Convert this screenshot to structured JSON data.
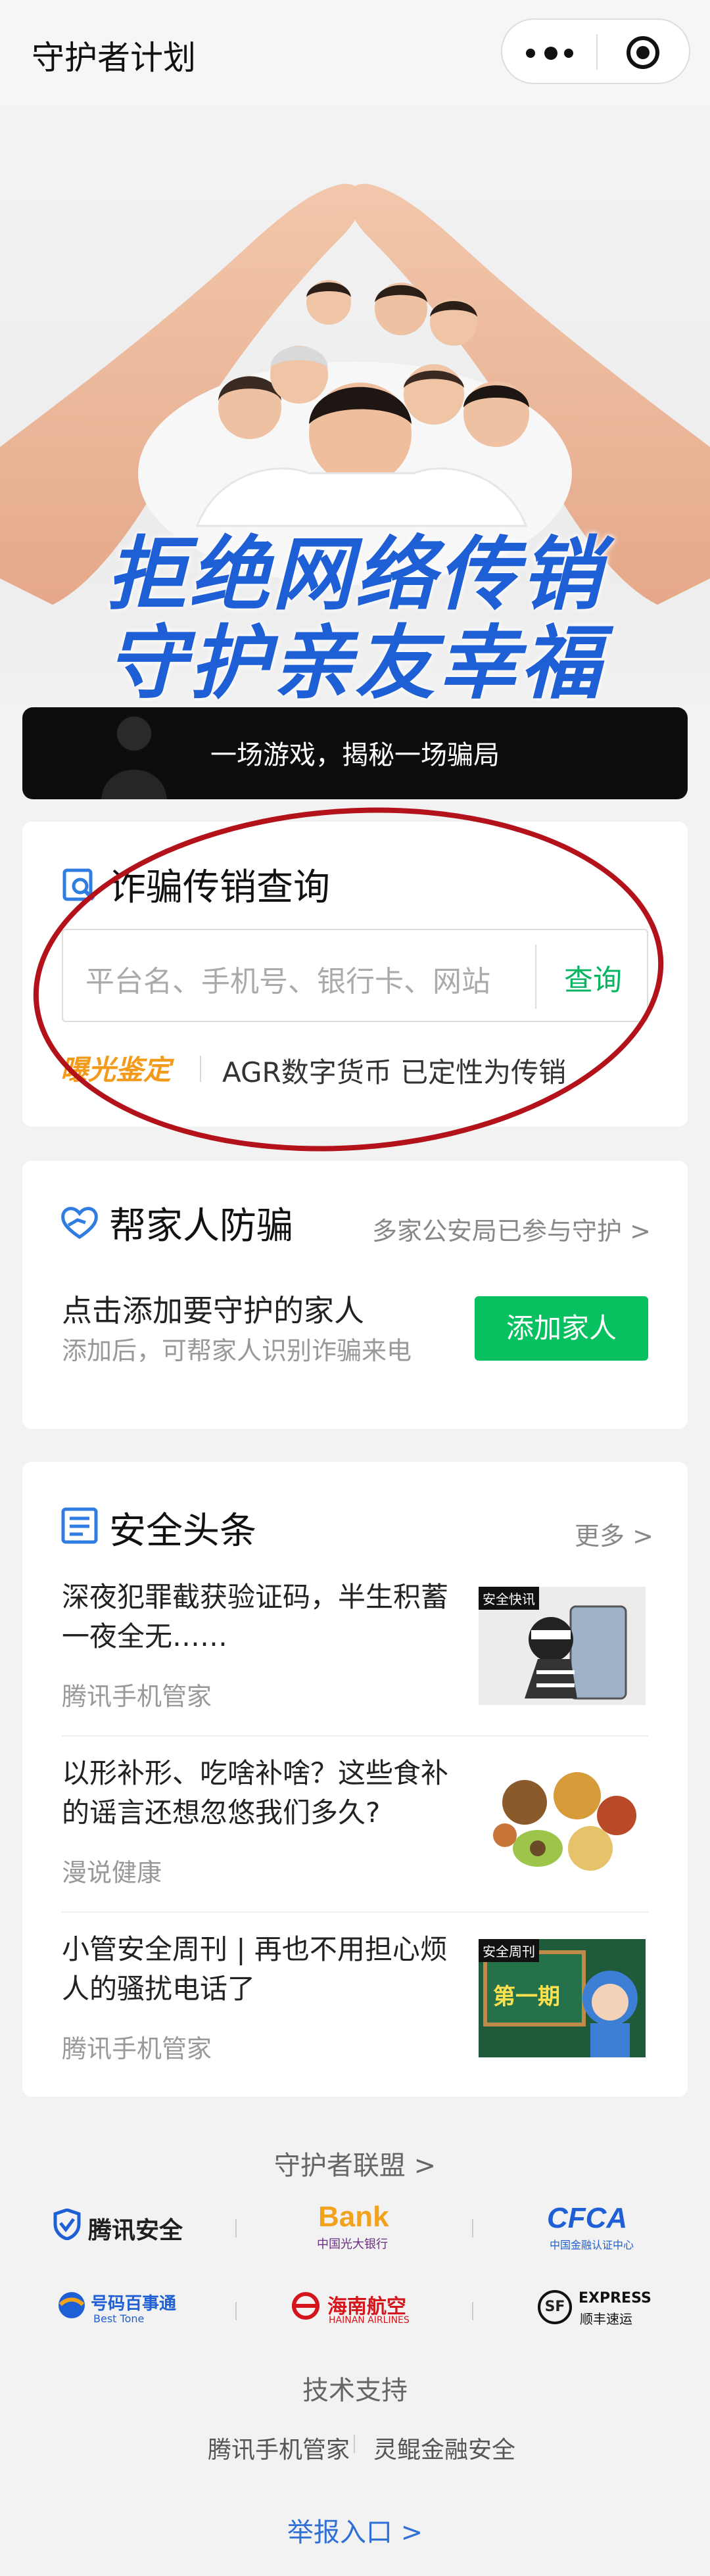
{
  "app": {
    "title": "守护者计划"
  },
  "hero": {
    "headline_line1": "拒绝网络传销",
    "headline_line2": "守护亲友幸福",
    "banner_text": "一场游戏，揭秘一场骗局"
  },
  "fraud_query": {
    "title": "诈骗传销查询",
    "placeholder": "平台名、手机号、银行卡、网站",
    "button": "查询",
    "badge": "曝光鉴定",
    "notice": "AGR数字货币 已定性为传销"
  },
  "family": {
    "title": "帮家人防骗",
    "link": "多家公安局已参与守护 >",
    "main_text": "点击添加要守护的家人",
    "sub_text": "添加后，可帮家人识别诈骗来电",
    "button": "添加家人"
  },
  "news": {
    "title": "安全头条",
    "more": "更多 >",
    "items": [
      {
        "title": "深夜犯罪截获验证码，半生积蓄一夜全无……",
        "source": "腾讯手机管家",
        "tag": "安全快讯"
      },
      {
        "title": "以形补形、吃啥补啥？这些食补的谣言还想忽悠我们多久?",
        "source": "漫说健康",
        "tag": ""
      },
      {
        "title": "小管安全周刊 | 再也不用担心烦人的骚扰电话了",
        "source": "腾讯手机管家",
        "tag": "安全周刊",
        "badge": "第一期"
      }
    ]
  },
  "footer": {
    "alliance_link": "守护者联盟 >",
    "partners": [
      "腾讯安全",
      "Bank",
      "中国光大银行",
      "CFCA",
      "中国金融认证中心",
      "号码百事通",
      "Best Tone",
      "海南航空",
      "HAINAN AIRLINES",
      "EXPRESS",
      "顺丰速运",
      "SF"
    ],
    "tech_support": "技术支持",
    "tech_partners": [
      "腾讯手机管家",
      "灵鲲金融安全"
    ],
    "report_link": "举报入口 >"
  },
  "colors": {
    "accent_green": "#07c160",
    "badge_orange": "#f39a1b",
    "annotation_red": "#b3121a",
    "hero_blue": "#1f5fd6"
  },
  "icons": [
    "more-dots-icon",
    "target-icon",
    "search-doc-icon",
    "heart-hand-icon",
    "news-icon",
    "chevron-right-icon"
  ]
}
